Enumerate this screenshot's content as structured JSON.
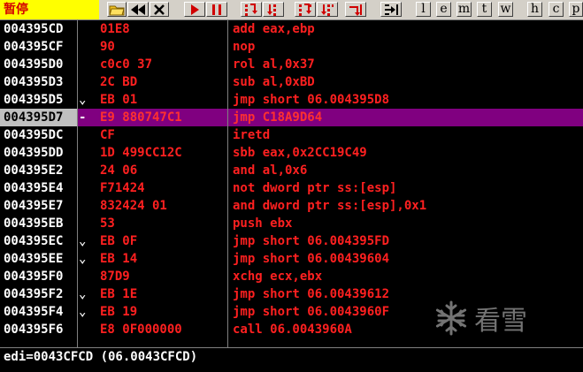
{
  "status": {
    "label": "暂停"
  },
  "toolbar": {
    "buttons": [
      "open-icon",
      "rewind-icon",
      "close-icon",
      "run-icon",
      "pause-icon",
      "step-into-icon",
      "step-over-icon",
      "trace-into-icon",
      "trace-over-icon",
      "execute-till-return-icon",
      "goto-icon"
    ],
    "letters": [
      "l",
      "e",
      "m",
      "t",
      "w",
      "h",
      "c",
      "p"
    ]
  },
  "rows": [
    {
      "addr": "004395CD",
      "mark": "",
      "hex": "01E8",
      "asm": "add eax,ebp"
    },
    {
      "addr": "004395CF",
      "mark": "",
      "hex": "90",
      "asm": "nop"
    },
    {
      "addr": "004395D0",
      "mark": "",
      "hex": "c0c0 37",
      "asm": "rol al,0x37"
    },
    {
      "addr": "004395D3",
      "mark": "",
      "hex": "2C BD",
      "asm": "sub al,0xBD"
    },
    {
      "addr": "004395D5",
      "mark": "⌄",
      "hex": "EB 01",
      "asm": "jmp short 06.004395D8"
    },
    {
      "addr": "004395D7",
      "mark": "-",
      "hex": "E9 880747C1",
      "asm": "jmp C18A9D64"
    },
    {
      "addr": "004395DC",
      "mark": "",
      "hex": "CF",
      "asm": "iretd"
    },
    {
      "addr": "004395DD",
      "mark": "",
      "hex": "1D 499CC12C",
      "asm": "sbb eax,0x2CC19C49"
    },
    {
      "addr": "004395E2",
      "mark": "",
      "hex": "24 06",
      "asm": "and al,0x6"
    },
    {
      "addr": "004395E4",
      "mark": "",
      "hex": "F71424",
      "asm": "not dword ptr ss:[esp]"
    },
    {
      "addr": "004395E7",
      "mark": "",
      "hex": "832424 01",
      "asm": "and dword ptr ss:[esp],0x1"
    },
    {
      "addr": "004395EB",
      "mark": "",
      "hex": "53",
      "asm": "push ebx"
    },
    {
      "addr": "004395EC",
      "mark": "⌄",
      "hex": "EB 0F",
      "asm": "jmp short 06.004395FD"
    },
    {
      "addr": "004395EE",
      "mark": "⌄",
      "hex": "EB 14",
      "asm": "jmp short 06.00439604"
    },
    {
      "addr": "004395F0",
      "mark": "",
      "hex": "87D9",
      "asm": "xchg ecx,ebx"
    },
    {
      "addr": "004395F2",
      "mark": "⌄",
      "hex": "EB 1E",
      "asm": "jmp short 06.00439612"
    },
    {
      "addr": "004395F4",
      "mark": "⌄",
      "hex": "EB 19",
      "asm": "jmp short 06.0043960F"
    },
    {
      "addr": "004395F6",
      "mark": "",
      "hex": "E8 0F000000",
      "asm": "call 06.0043960A"
    }
  ],
  "selected_row": 5,
  "watermark": {
    "text": "看雪"
  },
  "info": {
    "text": "edi=0043CFCD (06.0043CFCD)"
  },
  "colors": {
    "hex_text": "#ff2020",
    "selection": "#800080",
    "status_bg": "#ffff00"
  }
}
